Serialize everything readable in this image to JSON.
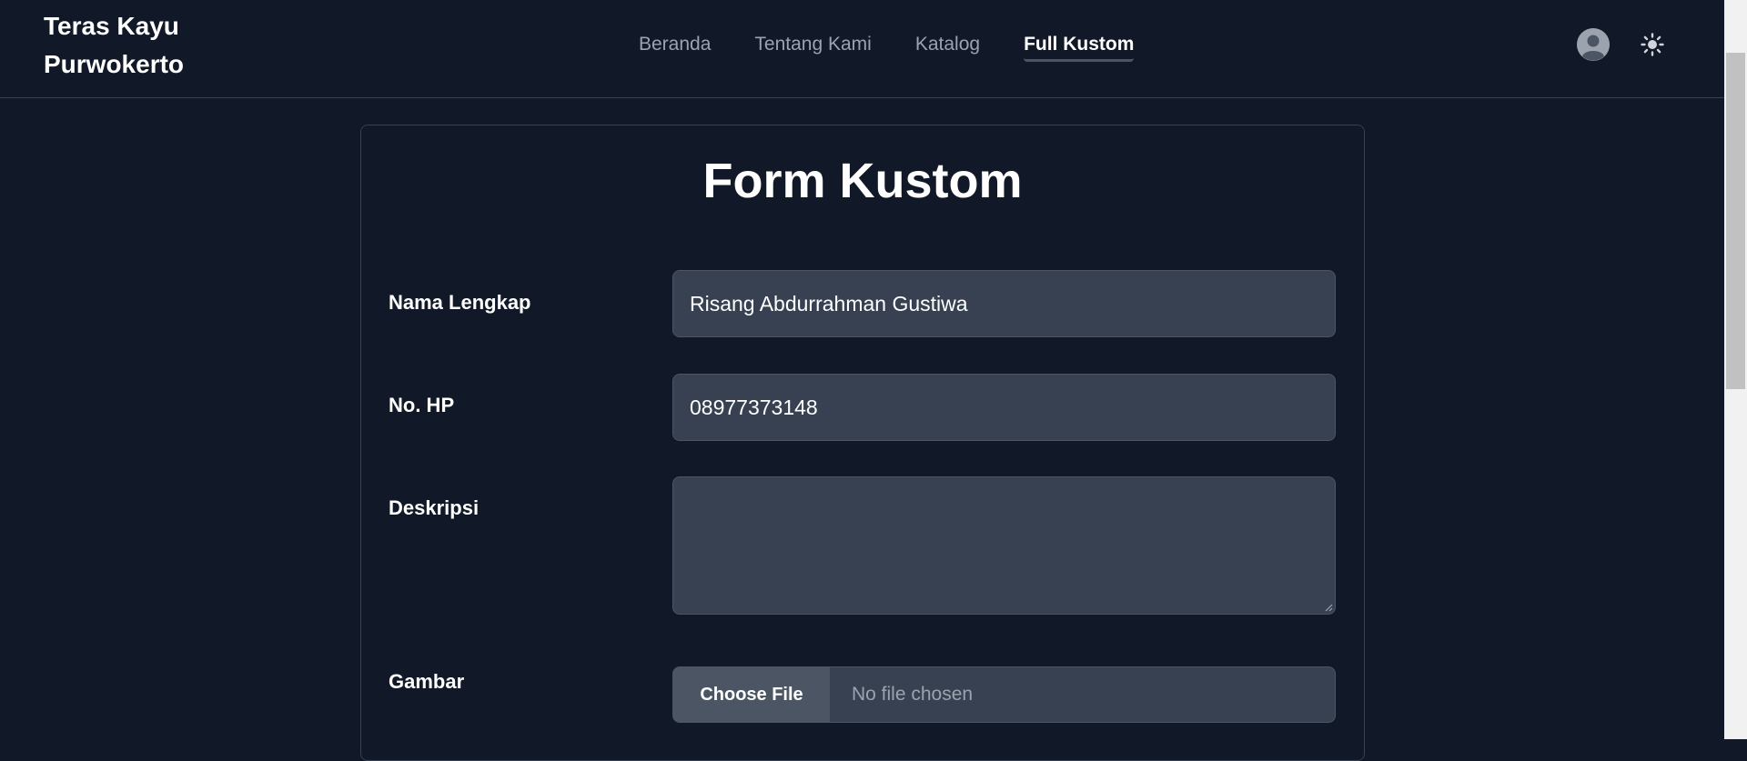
{
  "header": {
    "brand": "Teras Kayu Purwokerto",
    "nav": [
      {
        "label": "Beranda",
        "active": false
      },
      {
        "label": "Tentang Kami",
        "active": false
      },
      {
        "label": "Katalog",
        "active": false
      },
      {
        "label": "Full Kustom",
        "active": true
      }
    ],
    "avatar_icon": "user-avatar-icon",
    "theme_icon": "sun-icon"
  },
  "form": {
    "title": "Form Kustom",
    "fields": {
      "nama": {
        "label": "Nama Lengkap",
        "value": "Risang Abdurrahman Gustiwa"
      },
      "hp": {
        "label": "No. HP",
        "value": "08977373148"
      },
      "deskripsi": {
        "label": "Deskripsi",
        "value": ""
      },
      "gambar": {
        "label": "Gambar",
        "button": "Choose File",
        "status": "No file chosen"
      }
    }
  },
  "colors": {
    "background": "#111827",
    "input_bg": "#374151",
    "border": "#374151",
    "muted_text": "#9ca3af"
  }
}
